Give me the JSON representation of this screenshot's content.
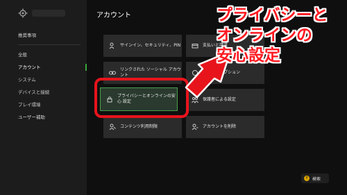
{
  "sidebar": {
    "items": [
      {
        "label": "推奨事項"
      },
      {
        "label": "全般"
      },
      {
        "label": "アカウント"
      },
      {
        "label": "システム"
      },
      {
        "label": "デバイスと接続"
      },
      {
        "label": "プレイ環境"
      },
      {
        "label": "ユーザー補助"
      }
    ]
  },
  "main": {
    "title": "アカウント",
    "tiles": [
      {
        "label": "サインイン、セキュリティ、PIN",
        "icon": "person-key-icon"
      },
      {
        "label": "支払いと請求",
        "icon": "card-icon"
      },
      {
        "label": "リンクされた ソーシャル アカウント",
        "icon": "link-icon"
      },
      {
        "label": "サブスクリプション",
        "icon": "subscription-icon"
      },
      {
        "label": "プライバシーとオンラインの安心 設定",
        "icon": "lock-icon"
      },
      {
        "label": "保護者による設定",
        "icon": "family-icon"
      },
      {
        "label": "コンテンツ利用制限",
        "icon": "content-icon"
      },
      {
        "label": "アカウントを削除",
        "icon": "person-remove-icon"
      }
    ]
  },
  "annotation": {
    "lines": [
      "プライバシーと",
      "オンラインの",
      "安心設定"
    ],
    "color": "#ff1a22"
  },
  "footer": {
    "button_key": "Y",
    "search_label": "検索"
  }
}
